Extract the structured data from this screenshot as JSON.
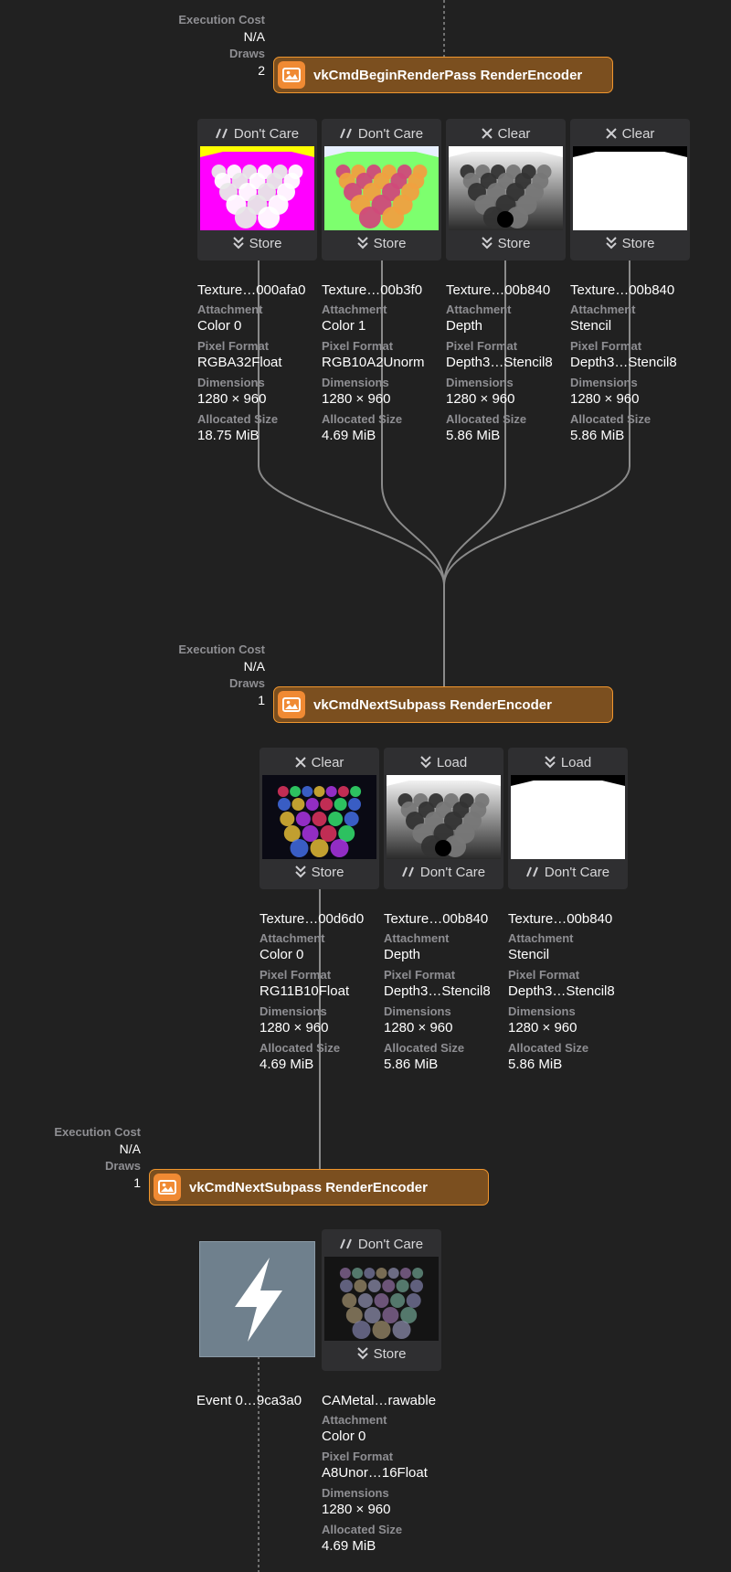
{
  "encoders": [
    {
      "label": "vkCmdBeginRenderPass RenderEncoder",
      "exec_cost_label": "Execution Cost",
      "exec_cost": "N/A",
      "draws_label": "Draws",
      "draws": "2"
    },
    {
      "label": "vkCmdNextSubpass RenderEncoder",
      "exec_cost_label": "Execution Cost",
      "exec_cost": "N/A",
      "draws_label": "Draws",
      "draws": "1"
    },
    {
      "label": "vkCmdNextSubpass RenderEncoder",
      "exec_cost_label": "Execution Cost",
      "exec_cost": "N/A",
      "draws_label": "Draws",
      "draws": "1"
    }
  ],
  "labels": {
    "attachment": "Attachment",
    "pixel_format": "Pixel Format",
    "dimensions": "Dimensions",
    "allocated_size": "Allocated Size"
  },
  "pass1": [
    {
      "load": "Don't Care",
      "store": "Store",
      "name": "Texture…000afa0",
      "attachment": "Color 0",
      "format": "RGBA32Float",
      "dims": "1280 × 960",
      "size": "18.75 MiB"
    },
    {
      "load": "Don't Care",
      "store": "Store",
      "name": "Texture…00b3f0",
      "attachment": "Color 1",
      "format": "RGB10A2Unorm",
      "dims": "1280 × 960",
      "size": "4.69 MiB"
    },
    {
      "load": "Clear",
      "store": "Store",
      "name": "Texture…00b840",
      "attachment": "Depth",
      "format": "Depth3…Stencil8",
      "dims": "1280 × 960",
      "size": "5.86 MiB"
    },
    {
      "load": "Clear",
      "store": "Store",
      "name": "Texture…00b840",
      "attachment": "Stencil",
      "format": "Depth3…Stencil8",
      "dims": "1280 × 960",
      "size": "5.86 MiB"
    }
  ],
  "pass2": [
    {
      "load": "Clear",
      "store": "Store",
      "name": "Texture…00d6d0",
      "attachment": "Color 0",
      "format": "RG11B10Float",
      "dims": "1280 × 960",
      "size": "4.69 MiB"
    },
    {
      "load": "Load",
      "store": "Don't Care",
      "name": "Texture…00b840",
      "attachment": "Depth",
      "format": "Depth3…Stencil8",
      "dims": "1280 × 960",
      "size": "5.86 MiB"
    },
    {
      "load": "Load",
      "store": "Don't Care",
      "name": "Texture…00b840",
      "attachment": "Stencil",
      "format": "Depth3…Stencil8",
      "dims": "1280 × 960",
      "size": "5.86 MiB"
    }
  ],
  "pass3": {
    "event_name": "Event 0…9ca3a0",
    "event_icon": "lightning-bolt-icon",
    "attachment": {
      "load": "Don't Care",
      "store": "Store",
      "name": "CAMetal…rawable",
      "attachment": "Color 0",
      "format": "A8Unor…16Float",
      "dims": "1280 × 960",
      "size": "4.69 MiB"
    }
  },
  "colors": {
    "background": "#212121",
    "encoder_fill": "#7b4f1f",
    "encoder_border": "#f0962e",
    "encoder_icon": "#f08a33",
    "wire": "#8a8a8a",
    "card": "#2f2f31"
  }
}
